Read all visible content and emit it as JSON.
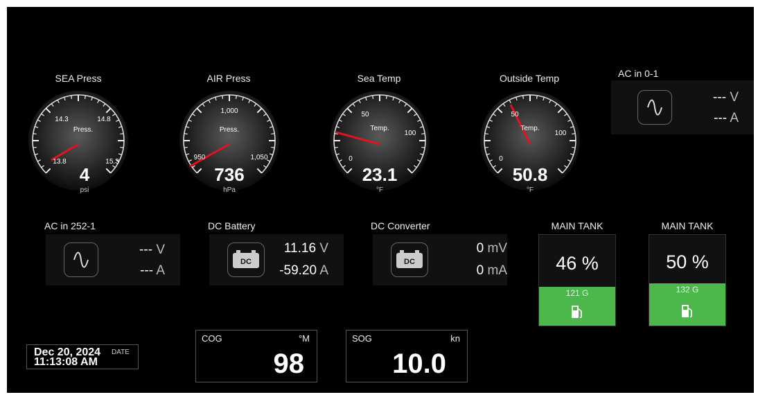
{
  "gauges": [
    {
      "title": "SEA Press",
      "center_label": "Press.",
      "value": "4",
      "unit": "psi",
      "ticks": [
        "13.8",
        "14.3",
        "14.8",
        "15.3"
      ],
      "needle_fraction": 0.03
    },
    {
      "title": "AIR Press",
      "center_label": "Press.",
      "value": "736",
      "unit": "hPa",
      "ticks": [
        "950",
        "1,000",
        "1,050"
      ],
      "needle_fraction": 0.03
    },
    {
      "title": "Sea Temp",
      "center_label": "Temp.",
      "value": "23.1",
      "unit": "°F",
      "ticks": [
        "0",
        "50",
        "100"
      ],
      "needle_fraction": 0.22
    },
    {
      "title": "Outside Temp",
      "center_label": "Temp.",
      "value": "50.8",
      "unit": "°F",
      "ticks": [
        "0",
        "50",
        "100"
      ],
      "needle_fraction": 0.4
    }
  ],
  "ac_panels": [
    {
      "title": "AC in 0-1",
      "voltage": "---",
      "voltage_unit": "V",
      "current": "---",
      "current_unit": "A"
    },
    {
      "title": "AC in 252-1",
      "voltage": "---",
      "voltage_unit": "V",
      "current": "---",
      "current_unit": "A"
    }
  ],
  "dc_panels": [
    {
      "title": "DC Battery",
      "icon_text": "DC",
      "voltage": "11.16",
      "voltage_unit": "V",
      "current": "-59.20",
      "current_unit": "A"
    },
    {
      "title": "DC Converter",
      "icon_text": "DC",
      "voltage": "0",
      "voltage_unit": "mV",
      "current": "0",
      "current_unit": "mA"
    }
  ],
  "tanks": [
    {
      "title": "MAIN TANK",
      "percent": "46 %",
      "level_fraction": 0.46,
      "gallons": "121 G"
    },
    {
      "title": "MAIN TANK",
      "percent": "50 %",
      "level_fraction": 0.5,
      "gallons": "132 G"
    }
  ],
  "datetime": {
    "date": "Dec 20, 2024",
    "date_tag": "DATE",
    "time": "11:13:08 AM"
  },
  "cog": {
    "label": "COG",
    "unit": "°M",
    "value": "98"
  },
  "sog": {
    "label": "SOG",
    "unit": "kn",
    "value": "10.0"
  },
  "colors": {
    "background": "#000000",
    "needle": "#e0141e",
    "tank_fill": "#4cb74a"
  }
}
